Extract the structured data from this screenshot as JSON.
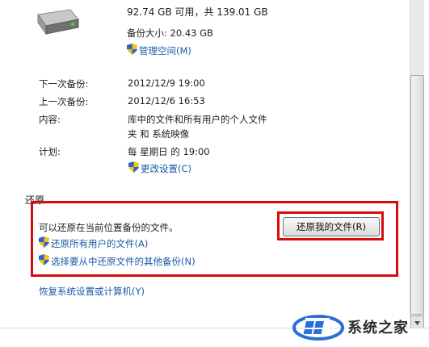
{
  "drive": {
    "free_space": "92.74 GB 可用，共 139.01 GB",
    "backup_size": "备份大小: 20.43 GB",
    "manage_space_link": "管理空间(M)"
  },
  "schedule": {
    "next_backup_label": "下一次备份:",
    "next_backup_value": "2012/12/9 19:00",
    "last_backup_label": "上一次备份:",
    "last_backup_value": "2012/12/6 16:53",
    "contents_label": "内容:",
    "contents_value_line1": "库中的文件和所有用户的个人文件",
    "contents_value_line2": "夹 和 系统映像",
    "plan_label": "计划:",
    "plan_value": "每 星期日 的 19:00",
    "change_settings_link": "更改设置(C)"
  },
  "restore": {
    "section_title": "还原",
    "description": "可以还原在当前位置备份的文件。",
    "restore_my_files_button": "还原我的文件(R)",
    "restore_all_users_link": "还原所有用户的文件(A)",
    "select_other_backup_link": "选择要从中还原文件的其他备份(N)",
    "recover_system_link": "恢复系统设置或计算机(Y)"
  },
  "watermark": {
    "text": "系统之家"
  },
  "colors": {
    "link": "#1b5aa6",
    "highlight_box": "#d90b0b"
  }
}
